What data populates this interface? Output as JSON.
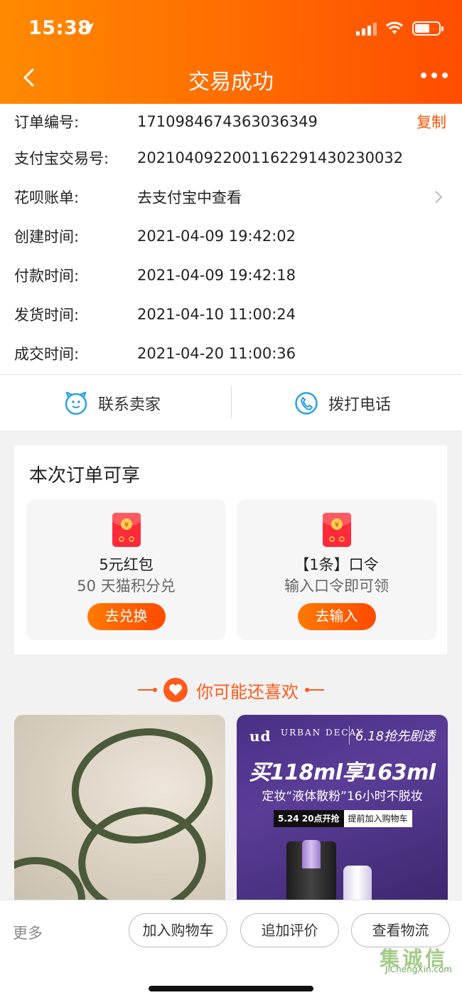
{
  "status_bar": {
    "time": "15:38"
  },
  "nav": {
    "title": "交易成功"
  },
  "order_info": {
    "rows": [
      {
        "label": "订单编号:",
        "value": "1710984674363036349",
        "action": "复制"
      },
      {
        "label": "支付宝交易号:",
        "value": "2021040922001162291430230032"
      },
      {
        "label": "花呗账单:",
        "value": "去支付宝中查看"
      },
      {
        "label": "创建时间:",
        "value": "2021-04-09 19:42:02"
      },
      {
        "label": "付款时间:",
        "value": "2021-04-09 19:42:18"
      },
      {
        "label": "发货时间:",
        "value": "2021-04-10 11:00:24"
      },
      {
        "label": "成交时间:",
        "value": "2021-04-20 11:00:36"
      }
    ]
  },
  "contact": {
    "seller": "联系卖家",
    "phone": "拨打电话"
  },
  "perks": {
    "title": "本次订单可享",
    "cards": [
      {
        "name": "5元红包",
        "desc": "50 天猫积分兑",
        "button": "去兑换"
      },
      {
        "name": "【1条】口令",
        "desc": "输入口令即可领",
        "button": "去输入"
      }
    ]
  },
  "recommend": {
    "title": "你可能还喜欢",
    "ad": {
      "brand": "ud",
      "brand_sub": "URBAN DECAY",
      "promo": "6.18抢先剧透",
      "headline": "买118ml享163ml",
      "sub": "定妆“液体散粉”16小时不脱妆",
      "chip_time": "5.24 20点开抢",
      "chip_action": "提前加入购物车"
    }
  },
  "bottom_bar": {
    "more": "更多",
    "add_cart": "加入购物车",
    "add_review": "追加评价",
    "logistics": "查看物流"
  },
  "watermark": {
    "mark": "集诚信",
    "url": "JiChengXin.com"
  },
  "colors": {
    "accent": "#ff5000",
    "header_start": "#ff8a00",
    "header_end": "#ff4d00",
    "contact_icon": "#2aa1e6"
  }
}
